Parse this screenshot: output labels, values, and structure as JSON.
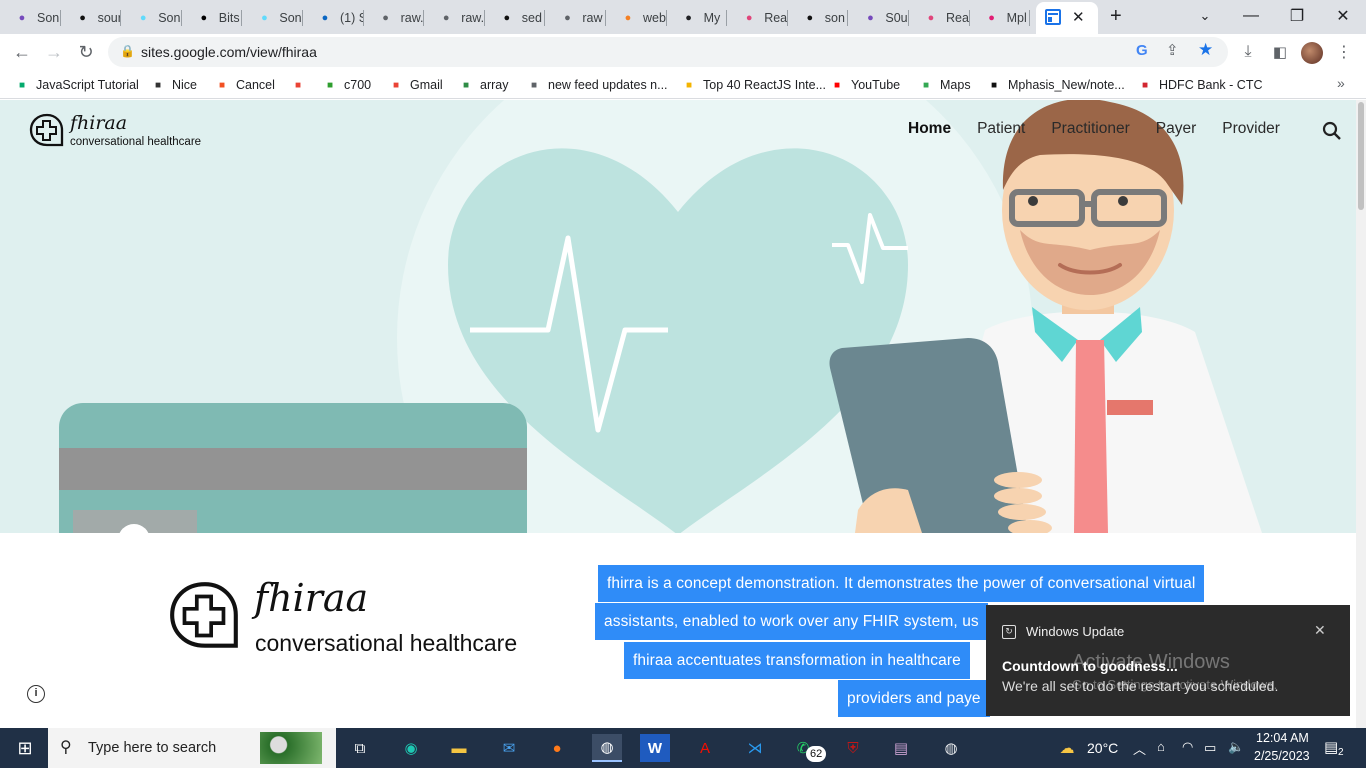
{
  "browser": {
    "tabs": [
      {
        "label": "Son",
        "icon": "redux-icon",
        "color": "#764abc"
      },
      {
        "label": "sour",
        "icon": "github-icon",
        "color": "#111111"
      },
      {
        "label": "Son",
        "icon": "react-icon",
        "color": "#61dafb"
      },
      {
        "label": "Bits",
        "icon": "triangle-icon",
        "color": "#000000"
      },
      {
        "label": "Son",
        "icon": "react-icon",
        "color": "#61dafb"
      },
      {
        "label": "(1) S",
        "icon": "linkedin-icon",
        "color": "#0a66c2"
      },
      {
        "label": "raw.",
        "icon": "globe-icon",
        "color": "#5f6368"
      },
      {
        "label": "raw.",
        "icon": "globe-icon",
        "color": "#5f6368"
      },
      {
        "label": "sed",
        "icon": "github-icon",
        "color": "#111111"
      },
      {
        "label": "raw",
        "icon": "globe-icon",
        "color": "#5f6368"
      },
      {
        "label": "web",
        "icon": "stackoverflow-icon",
        "color": "#f48024"
      },
      {
        "label": "My",
        "icon": "code-icon",
        "color": "#202124"
      },
      {
        "label": "Rea",
        "icon": "react-icon",
        "color": "#e0457b"
      },
      {
        "label": "son",
        "icon": "github-icon",
        "color": "#111111"
      },
      {
        "label": "S0u",
        "icon": "redux-icon",
        "color": "#764abc"
      },
      {
        "label": "Rea",
        "icon": "react-icon",
        "color": "#e0457b"
      },
      {
        "label": "Mpl",
        "icon": "mphasis-icon",
        "color": "#e11d74"
      }
    ],
    "active_tab_icon": "sites-icon",
    "url": "sites.google.com/view/fhiraa"
  },
  "bookmarks": [
    {
      "label": "JavaScript Tutorial",
      "icon": "w3schools-icon",
      "color": "#04aa6d"
    },
    {
      "label": "Nice",
      "icon": "jdoodle-icon",
      "color": "#333333"
    },
    {
      "label": "Cancel",
      "icon": "microsoft-icon",
      "color": "#f25022"
    },
    {
      "label": "",
      "icon": "gmail-icon",
      "color": "#ea4335"
    },
    {
      "label": "c700",
      "icon": "counter-icon",
      "color": "#2e9e2e"
    },
    {
      "label": "Gmail",
      "icon": "gmail-icon",
      "color": "#ea4335"
    },
    {
      "label": "array",
      "icon": "gfg-icon",
      "color": "#2f8d46"
    },
    {
      "label": "new feed updates n...",
      "icon": "globe-icon",
      "color": "#5f6368"
    },
    {
      "label": "Top 40 ReactJS Inte...",
      "icon": "bar-icon",
      "color": "#f4b400"
    },
    {
      "label": "YouTube",
      "icon": "youtube-icon",
      "color": "#ff0000"
    },
    {
      "label": "Maps",
      "icon": "maps-icon",
      "color": "#34a853"
    },
    {
      "label": "Mphasis_New/note...",
      "icon": "github-icon",
      "color": "#111111"
    },
    {
      "label": "HDFC Bank - CTC",
      "icon": "hdfc-icon",
      "color": "#d22630"
    }
  ],
  "site": {
    "logo_title": "fhiraa",
    "logo_subtitle": "conversational healthcare",
    "nav": [
      "Home",
      "Patient",
      "Practitioner",
      "Payer",
      "Provider"
    ],
    "big_logo_title": "fhiraa",
    "big_logo_subtitle": "conversational healthcare",
    "description_lines": [
      "fhirra is a concept demonstration. It demonstrates the power of conversational virtual",
      "assistants, enabled to work over any FHIR system, us",
      "fhiraa accentuates transformation in healthcare",
      "providers and paye"
    ]
  },
  "notification": {
    "app": "Windows Update",
    "title": "Countdown to goodness...",
    "body": "We're all set to do the restart you scheduled.",
    "watermark_line1": "Activate Windows",
    "watermark_line2": "Go to Settings to activate Windows."
  },
  "taskbar": {
    "search_placeholder": "Type here to search",
    "whatsapp_badge": "62",
    "temperature": "20°C",
    "time": "12:04 AM",
    "date": "2/25/2023",
    "notification_count": "2"
  },
  "colors": {
    "selection": "#2f8cf8",
    "hero_bg": "#dff0ef",
    "taskbar": "#203046"
  }
}
